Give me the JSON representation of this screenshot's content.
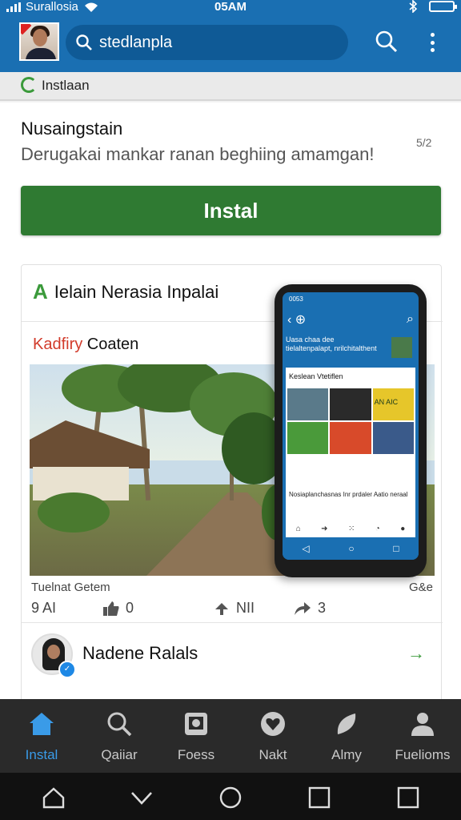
{
  "status_bar": {
    "carrier": "Surallosia",
    "time": "05AM"
  },
  "app_bar": {
    "search_text": "stedlanpla"
  },
  "install_strip": {
    "label": "Instlaan"
  },
  "app": {
    "title": "Nusaingstain",
    "description": "Derugakai mankar ranan beghiing amamgan!",
    "rating": "5/2",
    "install_label": "Instal"
  },
  "card": {
    "heading": "Ielain Nerasia Inpalai",
    "heading_icon": "A",
    "sub_red": "Kadfiry",
    "sub_rest": " Coaten",
    "phone_screen": {
      "status": "0053",
      "hero_text": "Uasa chaa dee tielaltenpalapt, nrilchitalthent",
      "content_title": "Keslean Vtetiflen",
      "caption": "Nosiaplanchasnas Inr prdaler Aatio neraal",
      "grid_label": "AN AIC"
    },
    "caption": "Tuelnat Getem",
    "caption_right": "G&e",
    "actions": {
      "comments": "9 AI",
      "likes": "0",
      "reactions": "NII",
      "shares": "3"
    },
    "person_name": "Nadene Ralals"
  },
  "bottom_nav": {
    "tabs": [
      {
        "label": "Instal",
        "icon": "home-icon"
      },
      {
        "label": "Qaiiar",
        "icon": "search-icon"
      },
      {
        "label": "Foess",
        "icon": "gallery-icon"
      },
      {
        "label": "Nakt",
        "icon": "heart-badge-icon"
      },
      {
        "label": "Almy",
        "icon": "leaf-icon"
      },
      {
        "label": "Fuelioms",
        "icon": "person-icon"
      }
    ]
  },
  "colors": {
    "app_bar": "#1a6fb2",
    "install_button": "#2f7a32",
    "accent_green": "#3b9a3b",
    "active_tab": "#3a9be8",
    "bottom_nav": "#2a2a2a"
  }
}
